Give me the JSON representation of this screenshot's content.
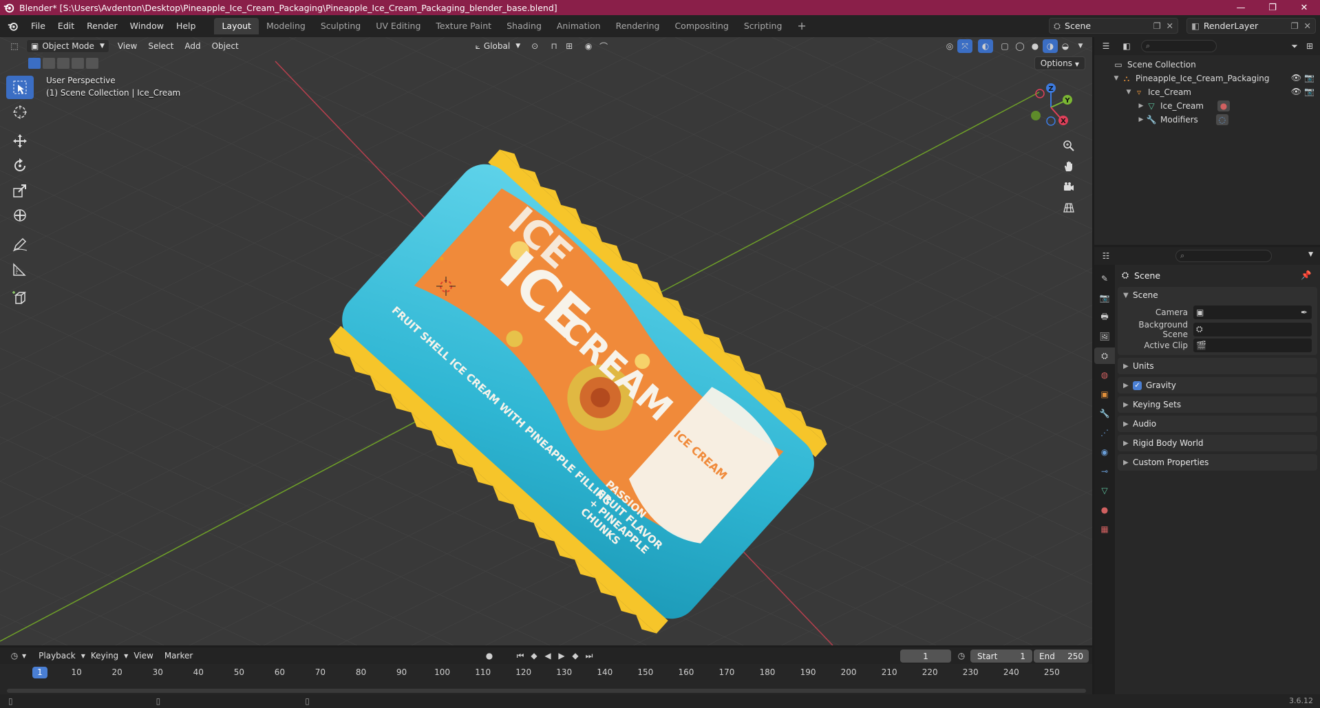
{
  "window": {
    "title": "Blender* [S:\\Users\\Avdenton\\Desktop\\Pineapple_Ice_Cream_Packaging\\Pineapple_Ice_Cream_Packaging_blender_base.blend]",
    "minimize": "—",
    "maximize": "❐",
    "close": "✕"
  },
  "menus": [
    "File",
    "Edit",
    "Render",
    "Window",
    "Help"
  ],
  "workspaces": [
    "Layout",
    "Modeling",
    "Sculpting",
    "UV Editing",
    "Texture Paint",
    "Shading",
    "Animation",
    "Rendering",
    "Compositing",
    "Scripting"
  ],
  "workspace_add": "+",
  "scene_selector": {
    "scene": "Scene",
    "view_layer": "RenderLayer"
  },
  "viewport": {
    "mode": "Object Mode",
    "menus": [
      "View",
      "Select",
      "Add",
      "Object"
    ],
    "orientation": "Global",
    "options_label": "Options",
    "info_line1": "User Perspective",
    "info_line2": "(1) Scene Collection | Ice_Cream",
    "gizmo_axes": {
      "x": "X",
      "y": "Y",
      "z": "Z"
    }
  },
  "package": {
    "brand_line1": "ICE",
    "brand_line2": "CREAM",
    "brand_peek": "ICE",
    "side_text": "FRUIT SHELL ICE CREAM WITH PINEAPPLE FILLING",
    "badge": "ICE CREAM",
    "flavor_line1": "PASSION",
    "flavor_line2": "FRUIT FLAVOR",
    "flavor_line3": "+ PINEAPPLE",
    "flavor_line4": "CHUNKS",
    "colors": {
      "wrapper": "#3ec3dd",
      "orange": "#f08a3a",
      "yellow": "#f6c52a",
      "white": "#f7f3ea"
    }
  },
  "outliner": {
    "root": "Scene Collection",
    "items": [
      {
        "label": "Pineapple_Ice_Cream_Packaging",
        "depth": 1,
        "icon": "collection-icon"
      },
      {
        "label": "Ice_Cream",
        "depth": 2,
        "icon": "object-icon"
      },
      {
        "label": "Ice_Cream",
        "depth": 3,
        "icon": "mesh-icon"
      },
      {
        "label": "Modifiers",
        "depth": 3,
        "icon": "wrench-icon"
      }
    ]
  },
  "properties": {
    "context": "Scene",
    "panel_scene": "Scene",
    "fields": [
      {
        "label": "Camera"
      },
      {
        "label": "Background Scene"
      },
      {
        "label": "Active Clip"
      }
    ],
    "panels": [
      "Units",
      "Gravity",
      "Keying Sets",
      "Audio",
      "Rigid Body World",
      "Custom Properties"
    ]
  },
  "timeline": {
    "menus": [
      "Playback",
      "Keying",
      "View",
      "Marker"
    ],
    "current_frame": "1",
    "start_label": "Start",
    "start": "1",
    "end_label": "End",
    "end": "250",
    "ticks": [
      "10",
      "20",
      "30",
      "40",
      "50",
      "60",
      "70",
      "80",
      "90",
      "100",
      "110",
      "120",
      "130",
      "140",
      "150",
      "160",
      "170",
      "180",
      "190",
      "200",
      "210",
      "220",
      "230",
      "240",
      "250"
    ],
    "marker": "1"
  },
  "status": {
    "version": "3.6.12"
  }
}
